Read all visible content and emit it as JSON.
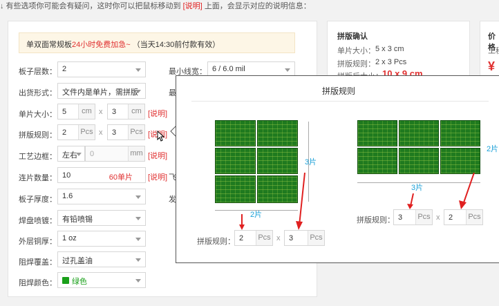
{
  "top_hint": {
    "prefix": "↓ 有些选项你可能会有疑问，这时你可以把鼠标移动到",
    "link": "[说明]",
    "suffix": "上面，会显示对应的说明信息："
  },
  "notice": {
    "text1": "单双面常规板",
    "red": "24小时免费加急~",
    "text2": "（当天14:30前付款有效）"
  },
  "form": {
    "layers": {
      "label": "板子层数：",
      "value": "2"
    },
    "min_trace": {
      "label": "最小线宽：",
      "value": "6 / 6.0 mil"
    },
    "delivery": {
      "label": "出货形式：",
      "value": "文件内是单片，需拼版"
    },
    "single_size": {
      "label": "单片大小：",
      "w": "5",
      "h": "3",
      "unit": "cm",
      "link": "[说明]"
    },
    "panel_rule": {
      "label": "拼版规则：",
      "a": "2",
      "b": "3",
      "unit": "Pcs",
      "link": "[说明]"
    },
    "edge": {
      "label": "工艺边框：",
      "value": "左右",
      "width": "0",
      "unit": "mm",
      "link": "[说明]"
    },
    "quantity": {
      "label": "连片数量：",
      "value": "10",
      "count": "60单片",
      "link": "[说明]",
      "suffix": "飞"
    },
    "thickness": {
      "label": "板子厚度：",
      "value": "1.6",
      "side": "发"
    },
    "finish": {
      "label": "焊盘喷镀：",
      "value": "有铅喷锡"
    },
    "copper": {
      "label": "外层铜厚：",
      "value": "1 oz"
    },
    "mask_cover": {
      "label": "阻焊覆盖：",
      "value": "过孔盖油"
    },
    "mask_color": {
      "label": "阻焊颜色：",
      "value": "绿色"
    },
    "hidden_label_1": "最"
  },
  "confirm": {
    "title": "拼版确认",
    "size_label": "单片大小：",
    "size_value": "5 x 3 cm",
    "rule_label": "拼版规则：",
    "rule_value": "2 x 3 Pcs",
    "after_label": "拼版后大小：",
    "after_value": "10 x 9 cm"
  },
  "price": {
    "title": "价格",
    "row": "工程",
    "symbol": "¥"
  },
  "popup": {
    "title": "拼版规则",
    "left": {
      "dim_h": "3片",
      "dim_w": "2片",
      "label": "拼版规则：",
      "a": "2",
      "b": "3",
      "unit": "Pcs"
    },
    "right": {
      "dim_h": "2片",
      "dim_w": "3片",
      "label": "拼版规则：",
      "a": "3",
      "b": "2",
      "unit": "Pcs"
    }
  }
}
